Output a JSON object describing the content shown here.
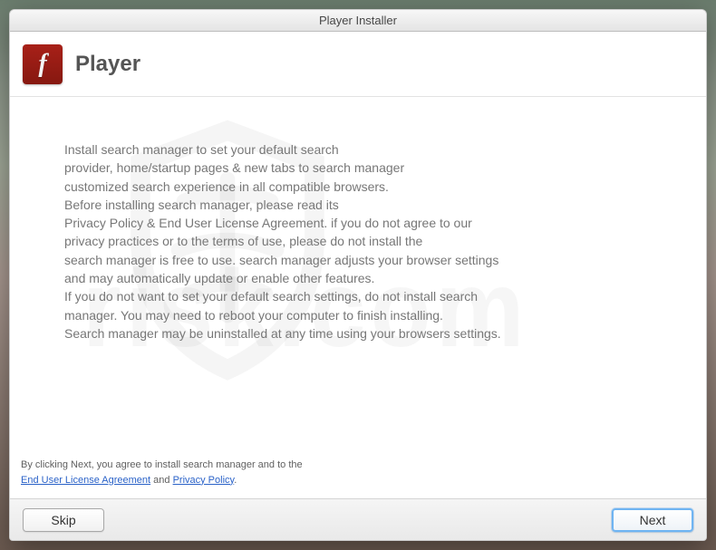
{
  "titlebar": {
    "title": "Player Installer"
  },
  "header": {
    "app_name": "Player",
    "icon_glyph": "f",
    "icon_name": "flash-icon"
  },
  "body": {
    "lines": [
      "Install search manager to set your default search",
      "provider, home/startup pages & new tabs to search manager",
      "customized search experience in all compatible browsers.",
      "Before installing search manager, please read its",
      "Privacy Policy & End User License Agreement. if you do not agree to our",
      "privacy practices or to the terms of use, please do not install the",
      "search manager is free to use. search manager adjusts your browser settings",
      "and may automatically update or enable other features.",
      "If you do not want to set your default search settings, do not install search",
      "manager. You may need to reboot your computer to finish installing.",
      "Search manager may be uninstalled at any time using your browsers settings."
    ]
  },
  "legal": {
    "prefix": "By clicking Next, you agree to install search manager and to the",
    "eula": "End User License Agreement",
    "and": " and ",
    "privacy": "Privacy Policy",
    "suffix": "."
  },
  "footer": {
    "skip_label": "Skip",
    "next_label": "Next"
  },
  "watermark": {
    "text": "risk.com"
  }
}
